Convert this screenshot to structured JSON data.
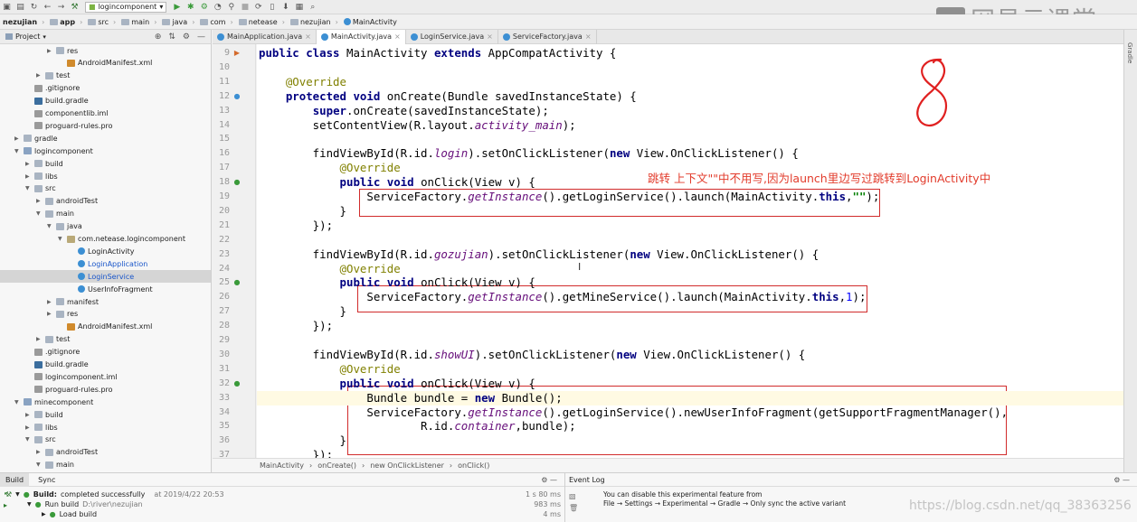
{
  "toolbar": {
    "config": "logincomponent"
  },
  "breadcrumb": [
    "nezujian",
    "app",
    "src",
    "main",
    "java",
    "com",
    "netease",
    "nezujian",
    "MainActivity"
  ],
  "project_panel": {
    "title": "Project"
  },
  "tree": [
    {
      "label": "res",
      "indent": 4,
      "type": "folder",
      "expanded": false
    },
    {
      "label": "AndroidManifest.xml",
      "indent": 5,
      "type": "xml"
    },
    {
      "label": "test",
      "indent": 3,
      "type": "folder",
      "expanded": false
    },
    {
      "label": ".gitignore",
      "indent": 2,
      "type": "file"
    },
    {
      "label": "build.gradle",
      "indent": 2,
      "type": "gradle"
    },
    {
      "label": "componentlib.iml",
      "indent": 2,
      "type": "file"
    },
    {
      "label": "proguard-rules.pro",
      "indent": 2,
      "type": "file"
    },
    {
      "label": "gradle",
      "indent": 1,
      "type": "folder",
      "expanded": false
    },
    {
      "label": "logincomponent",
      "indent": 1,
      "type": "module",
      "expanded": true
    },
    {
      "label": "build",
      "indent": 2,
      "type": "folder",
      "expanded": false
    },
    {
      "label": "libs",
      "indent": 2,
      "type": "folder",
      "expanded": false
    },
    {
      "label": "src",
      "indent": 2,
      "type": "folder",
      "expanded": true
    },
    {
      "label": "androidTest",
      "indent": 3,
      "type": "folder",
      "expanded": false
    },
    {
      "label": "main",
      "indent": 3,
      "type": "folder",
      "expanded": true
    },
    {
      "label": "java",
      "indent": 4,
      "type": "folder",
      "expanded": true
    },
    {
      "label": "com.netease.logincomponent",
      "indent": 5,
      "type": "package",
      "expanded": true
    },
    {
      "label": "LoginActivity",
      "indent": 6,
      "type": "class"
    },
    {
      "label": "LoginApplication",
      "indent": 6,
      "type": "class"
    },
    {
      "label": "LoginService",
      "indent": 6,
      "type": "class",
      "selected": true
    },
    {
      "label": "UserInfoFragment",
      "indent": 6,
      "type": "class"
    },
    {
      "label": "manifest",
      "indent": 4,
      "type": "folder",
      "expanded": false
    },
    {
      "label": "res",
      "indent": 4,
      "type": "folder",
      "expanded": false
    },
    {
      "label": "AndroidManifest.xml",
      "indent": 5,
      "type": "xml"
    },
    {
      "label": "test",
      "indent": 3,
      "type": "folder",
      "expanded": false
    },
    {
      "label": ".gitignore",
      "indent": 2,
      "type": "file"
    },
    {
      "label": "build.gradle",
      "indent": 2,
      "type": "gradle"
    },
    {
      "label": "logincomponent.iml",
      "indent": 2,
      "type": "file"
    },
    {
      "label": "proguard-rules.pro",
      "indent": 2,
      "type": "file"
    },
    {
      "label": "minecomponent",
      "indent": 1,
      "type": "module",
      "expanded": true
    },
    {
      "label": "build",
      "indent": 2,
      "type": "folder",
      "expanded": false
    },
    {
      "label": "libs",
      "indent": 2,
      "type": "folder",
      "expanded": false
    },
    {
      "label": "src",
      "indent": 2,
      "type": "folder",
      "expanded": true
    },
    {
      "label": "androidTest",
      "indent": 3,
      "type": "folder",
      "expanded": false
    },
    {
      "label": "main",
      "indent": 3,
      "type": "folder",
      "expanded": true
    }
  ],
  "tabs": [
    {
      "label": "MainApplication.java",
      "active": false
    },
    {
      "label": "MainActivity.java",
      "active": true
    },
    {
      "label": "LoginService.java",
      "active": false
    },
    {
      "label": "ServiceFactory.java",
      "active": false
    }
  ],
  "code": [
    {
      "n": "9",
      "parts": [
        [
          "kw",
          "public class "
        ],
        [
          "",
          "MainActivity "
        ],
        [
          "kw",
          "extends "
        ],
        [
          "",
          "AppCompatActivity {"
        ]
      ]
    },
    {
      "n": "10",
      "parts": []
    },
    {
      "n": "11",
      "parts": [
        [
          "",
          "    "
        ],
        [
          "an",
          "@Override"
        ]
      ]
    },
    {
      "n": "12",
      "parts": [
        [
          "",
          "    "
        ],
        [
          "kw",
          "protected void "
        ],
        [
          "",
          "onCreate(Bundle savedInstanceState) {"
        ]
      ]
    },
    {
      "n": "13",
      "parts": [
        [
          "",
          "        "
        ],
        [
          "kw",
          "super"
        ],
        [
          "",
          ".onCreate(savedInstanceState);"
        ]
      ]
    },
    {
      "n": "14",
      "parts": [
        [
          "",
          "        setContentView(R.layout."
        ],
        [
          "it",
          "activity_main"
        ],
        [
          "",
          ");"
        ]
      ]
    },
    {
      "n": "15",
      "parts": []
    },
    {
      "n": "16",
      "parts": [
        [
          "",
          "        findViewById(R.id."
        ],
        [
          "it",
          "login"
        ],
        [
          "",
          ").setOnClickListener("
        ],
        [
          "kw",
          "new "
        ],
        [
          "",
          "View.OnClickListener() {"
        ]
      ]
    },
    {
      "n": "17",
      "parts": [
        [
          "",
          "            "
        ],
        [
          "an",
          "@Override"
        ]
      ]
    },
    {
      "n": "18",
      "parts": [
        [
          "",
          "            "
        ],
        [
          "kw",
          "public void "
        ],
        [
          "",
          "onClick(View v) {"
        ]
      ]
    },
    {
      "n": "19",
      "parts": [
        [
          "",
          "                ServiceFactory."
        ],
        [
          "it",
          "getInstance"
        ],
        [
          "",
          "().getLoginService().launch(MainActivity."
        ],
        [
          "kw",
          "this"
        ],
        [
          "",
          ","
        ],
        [
          "st",
          "\"\""
        ],
        [
          "",
          ");"
        ]
      ]
    },
    {
      "n": "20",
      "parts": [
        [
          "",
          "            }"
        ]
      ]
    },
    {
      "n": "21",
      "parts": [
        [
          "",
          "        });"
        ]
      ]
    },
    {
      "n": "22",
      "parts": []
    },
    {
      "n": "23",
      "parts": [
        [
          "",
          "        findViewById(R.id."
        ],
        [
          "it",
          "gozujian"
        ],
        [
          "",
          ").setOnClickListener("
        ],
        [
          "kw",
          "new "
        ],
        [
          "",
          "View.OnClickListener() {"
        ]
      ]
    },
    {
      "n": "24",
      "parts": [
        [
          "",
          "            "
        ],
        [
          "an",
          "@Override"
        ]
      ]
    },
    {
      "n": "25",
      "parts": [
        [
          "",
          "            "
        ],
        [
          "kw",
          "public void "
        ],
        [
          "",
          "onClick(View v) {"
        ]
      ]
    },
    {
      "n": "26",
      "parts": [
        [
          "",
          "                ServiceFactory."
        ],
        [
          "it",
          "getInstance"
        ],
        [
          "",
          "().getMineService().launch(MainActivity."
        ],
        [
          "kw",
          "this"
        ],
        [
          "",
          ","
        ],
        [
          "nm",
          "1"
        ],
        [
          "",
          ");"
        ]
      ]
    },
    {
      "n": "27",
      "parts": [
        [
          "",
          "            }"
        ]
      ]
    },
    {
      "n": "28",
      "parts": [
        [
          "",
          "        });"
        ]
      ]
    },
    {
      "n": "29",
      "parts": []
    },
    {
      "n": "30",
      "parts": [
        [
          "",
          "        findViewById(R.id."
        ],
        [
          "it",
          "showUI"
        ],
        [
          "",
          ").setOnClickListener("
        ],
        [
          "kw",
          "new "
        ],
        [
          "",
          "View.OnClickListener() {"
        ]
      ]
    },
    {
      "n": "31",
      "parts": [
        [
          "",
          "            "
        ],
        [
          "an",
          "@Override"
        ]
      ]
    },
    {
      "n": "32",
      "parts": [
        [
          "",
          "            "
        ],
        [
          "kw",
          "public void "
        ],
        [
          "",
          "onClick(View v) {"
        ]
      ]
    },
    {
      "n": "33",
      "parts": [
        [
          "",
          "                Bundle bundle = "
        ],
        [
          "kw",
          "new "
        ],
        [
          "",
          "Bundle();"
        ]
      ]
    },
    {
      "n": "34",
      "parts": [
        [
          "",
          "                ServiceFactory."
        ],
        [
          "it",
          "getInstance"
        ],
        [
          "",
          "().getLoginService().newUserInfoFragment(getSupportFragmentManager(),"
        ]
      ]
    },
    {
      "n": "35",
      "parts": [
        [
          "",
          "                        R.id."
        ],
        [
          "it",
          "container"
        ],
        [
          "",
          ",bundle);"
        ]
      ]
    },
    {
      "n": "36",
      "parts": [
        [
          "",
          "            }"
        ]
      ]
    },
    {
      "n": "37",
      "parts": [
        [
          "",
          "        });"
        ]
      ]
    }
  ],
  "annotation_note": "跳转      上下文\"\"中不用写,因为launch里边写过跳转到LoginActivity中",
  "handwritten_digit": "8",
  "nav_path": [
    "MainActivity",
    "onCreate()",
    "new OnClickListener",
    "onClick()"
  ],
  "build_panel": {
    "tabs": [
      "Build",
      "Sync"
    ],
    "status_bold": "Build:",
    "status": "completed successfully",
    "timestamp": "at 2019/4/22 20:53",
    "time_total": "1 s 80 ms",
    "run_build": "Run build",
    "run_path": "D:\\river\\nezujian",
    "run_time": "983 ms",
    "load_build": "Load build",
    "load_time": "4 ms"
  },
  "event_log": {
    "title": "Event Log",
    "line1": "You can disable this experimental feature from",
    "line2": "File → Settings → Experimental → Gradle → Only sync the active variant"
  },
  "watermark": {
    "logo": "网易云课堂",
    "url": "https://blog.csdn.net/qq_38363256"
  },
  "right_strip": {
    "label": "Gradle"
  },
  "colors": {
    "annotation": "#e23b2b",
    "keyword": "#000080",
    "annotation_syntax": "#808000"
  }
}
